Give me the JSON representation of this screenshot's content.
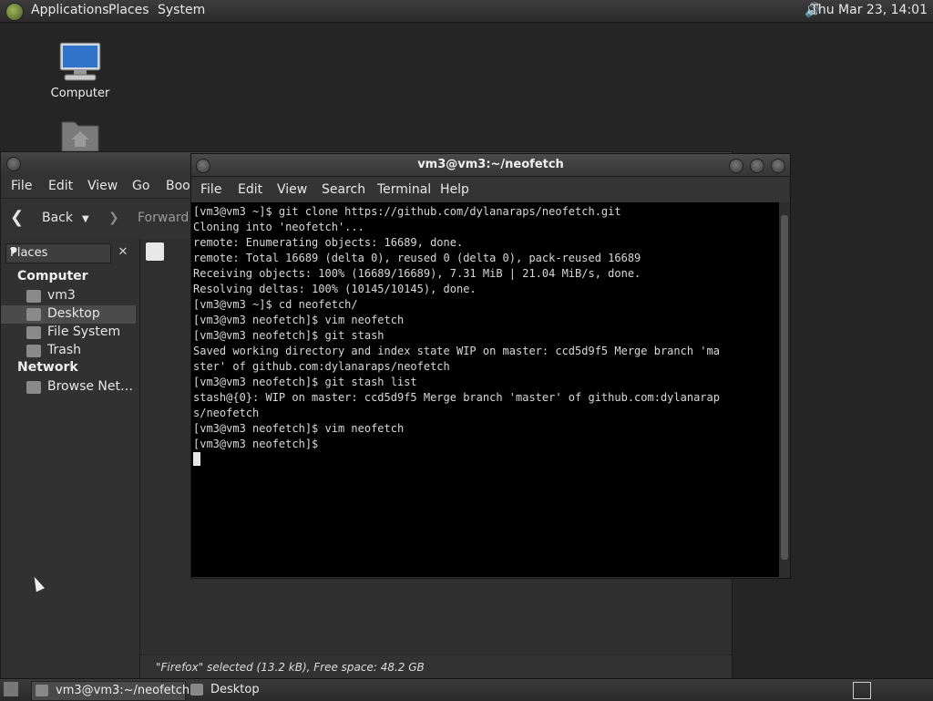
{
  "top_panel": {
    "menus": [
      "Applications",
      "Places",
      "System"
    ],
    "clock": "Thu Mar 23, 14:01",
    "volume_icon": "volume-icon"
  },
  "desktop": {
    "icons": [
      {
        "label": "Computer",
        "icon": "computer-icon"
      },
      {
        "label": "",
        "icon": "home-folder-icon"
      }
    ]
  },
  "file_manager": {
    "menu": [
      "File",
      "Edit",
      "View",
      "Go",
      "Book"
    ],
    "toolbar": {
      "back": "Back",
      "forward": "Forward"
    },
    "sidebar": {
      "combo": "Places",
      "sections": [
        {
          "title": "Computer",
          "items": [
            {
              "label": "vm3",
              "icon": "home-icon"
            },
            {
              "label": "Desktop",
              "icon": "desktop-icon",
              "selected": true
            },
            {
              "label": "File System",
              "icon": "drive-icon"
            },
            {
              "label": "Trash",
              "icon": "trash-icon"
            }
          ]
        },
        {
          "title": "Network",
          "items": [
            {
              "label": "Browse Net…",
              "icon": "network-icon"
            }
          ]
        }
      ]
    },
    "status": "\"Firefox\" selected (13.2 kB), Free space: 48.2 GB"
  },
  "terminal": {
    "title": "vm3@vm3:~/neofetch",
    "menu": [
      "File",
      "Edit",
      "View",
      "Search",
      "Terminal",
      "Help"
    ],
    "lines": [
      "[vm3@vm3 ~]$ git clone https://github.com/dylanaraps/neofetch.git",
      "Cloning into 'neofetch'...",
      "remote: Enumerating objects: 16689, done.",
      "remote: Total 16689 (delta 0), reused 0 (delta 0), pack-reused 16689",
      "Receiving objects: 100% (16689/16689), 7.31 MiB | 21.04 MiB/s, done.",
      "Resolving deltas: 100% (10145/10145), done.",
      "[vm3@vm3 ~]$ cd neofetch/",
      "[vm3@vm3 neofetch]$ vim neofetch",
      "[vm3@vm3 neofetch]$ git stash",
      "Saved working directory and index state WIP on master: ccd5d9f5 Merge branch 'ma",
      "ster' of github.com:dylanaraps/neofetch",
      "[vm3@vm3 neofetch]$ git stash list",
      "stash@{0}: WIP on master: ccd5d9f5 Merge branch 'master' of github.com:dylanarap",
      "s/neofetch",
      "[vm3@vm3 neofetch]$ vim neofetch"
    ],
    "prompt": "[vm3@vm3 neofetch]$ "
  },
  "bottom_panel": {
    "tasks": [
      {
        "label": "vm3@vm3:~/neofetch",
        "icon": "terminal-icon",
        "active": true
      },
      {
        "label": "Desktop",
        "icon": "file-manager-icon",
        "active": false
      }
    ]
  }
}
